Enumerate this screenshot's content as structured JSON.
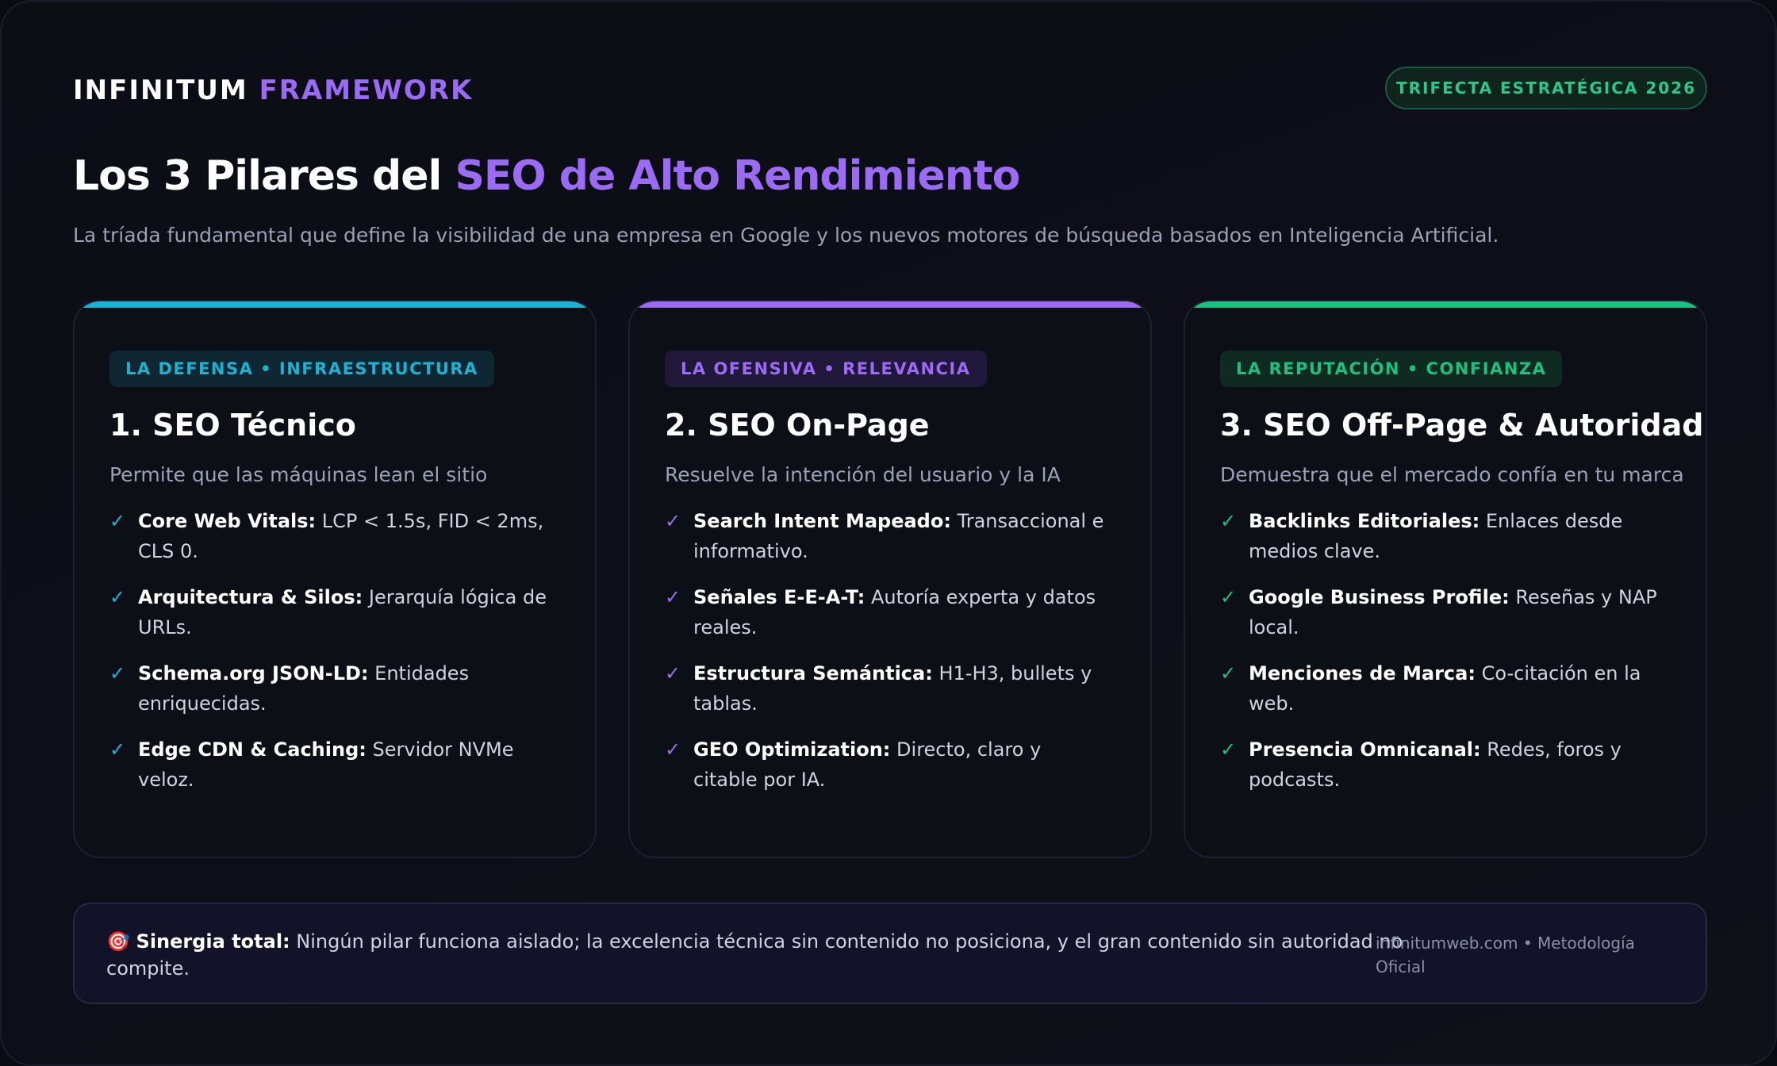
{
  "header": {
    "brand_main": "INFINITUM",
    "brand_accent": "FRAMEWORK",
    "badge": "TRIFECTA ESTRATÉGICA 2026"
  },
  "hero": {
    "title_main": "Los 3 Pilares del",
    "title_accent": "SEO de Alto Rendimiento",
    "subtitle": "La tríada fundamental que define la visibilidad de una empresa en Google y los nuevos motores de búsqueda basados en Inteligencia Artificial."
  },
  "colors": {
    "card1_accent": "#1ab4d3",
    "card2_accent": "#9b6bf5",
    "card3_accent": "#19c27e",
    "brand_accent": "#9b6bf5"
  },
  "cards": [
    {
      "tag": "LA DEFENSA • INFRAESTRUCTURA",
      "title": "1. SEO Técnico",
      "subtitle": "Permite que las máquinas lean el sitio",
      "items": [
        {
          "key": "Core Web Vitals:",
          "text": "LCP < 1.5s, FID < 2ms, CLS 0."
        },
        {
          "key": "Arquitectura & Silos:",
          "text": "Jerarquía lógica de URLs."
        },
        {
          "key": "Schema.org JSON-LD:",
          "text": "Entidades enriquecidas."
        },
        {
          "key": "Edge CDN & Caching:",
          "text": "Servidor NVMe veloz."
        }
      ]
    },
    {
      "tag": "LA OFENSIVA • RELEVANCIA",
      "title": "2. SEO On-Page",
      "subtitle": "Resuelve la intención del usuario y la IA",
      "items": [
        {
          "key": "Search Intent Mapeado:",
          "text": "Transaccional e informativo."
        },
        {
          "key": "Señales E-E-A-T:",
          "text": "Autoría experta y datos reales."
        },
        {
          "key": "Estructura Semántica:",
          "text": "H1-H3, bullets y tablas."
        },
        {
          "key": "GEO Optimization:",
          "text": "Directo, claro y citable por IA."
        }
      ]
    },
    {
      "tag": "LA REPUTACIÓN • CONFIANZA",
      "title": "3. SEO Off-Page & Autoridad",
      "subtitle": "Demuestra que el mercado confía en tu marca",
      "items": [
        {
          "key": "Backlinks Editoriales:",
          "text": "Enlaces desde medios clave."
        },
        {
          "key": "Google Business Profile:",
          "text": "Reseñas y NAP local."
        },
        {
          "key": "Menciones de Marca:",
          "text": "Co-citación en la web."
        },
        {
          "key": "Presencia Omnicanal:",
          "text": "Redes, foros y podcasts."
        }
      ]
    }
  ],
  "footer": {
    "emoji": "🎯",
    "key": "Sinergia total:",
    "text": "Ningún pilar funciona aislado; la excelencia técnica sin contenido no posiciona, y el gran contenido sin autoridad no compite.",
    "note": "infinitumweb.com • Metodología Oficial"
  },
  "icons": {
    "check": "check-icon",
    "target": "target-emoji-icon"
  }
}
